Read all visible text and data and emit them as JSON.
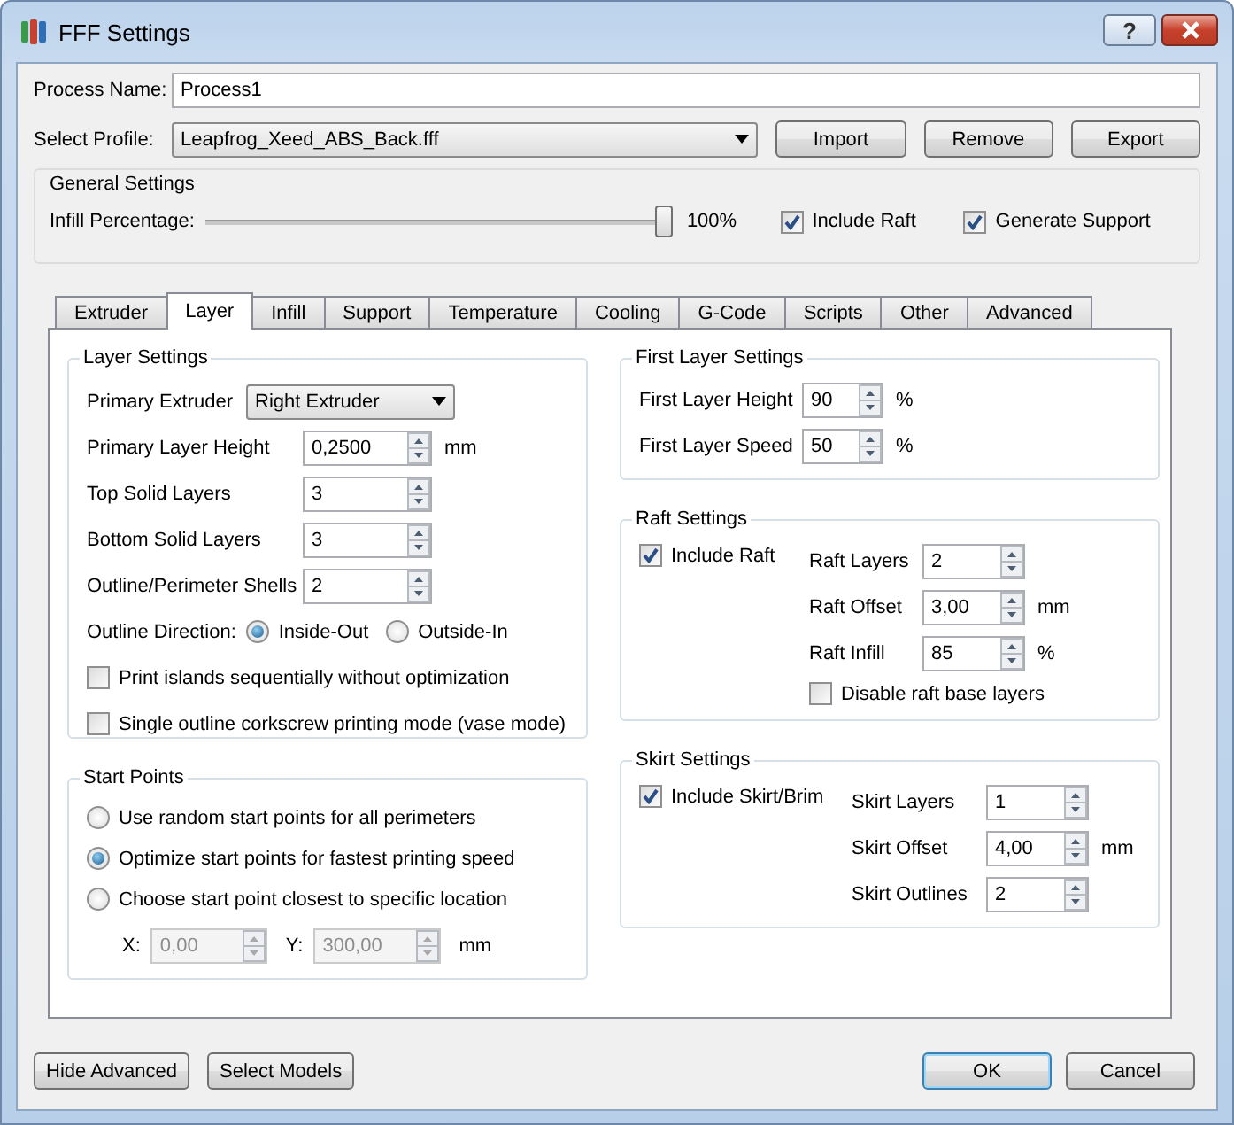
{
  "window": {
    "title": "FFF Settings",
    "help": "?"
  },
  "process_name": {
    "label": "Process Name:",
    "value": "Process1"
  },
  "profile": {
    "label": "Select Profile:",
    "value": "Leapfrog_Xeed_ABS_Back.fff",
    "buttons": [
      "Import",
      "Remove",
      "Export"
    ]
  },
  "general_settings": {
    "title": "General Settings",
    "infill": {
      "label": "Infill Percentage:",
      "level": 1,
      "reading": "100%"
    },
    "checkboxes": [
      {
        "label": "Include Raft",
        "checked": true
      },
      {
        "label": "Generate Support",
        "checked": true
      }
    ]
  },
  "tabs": [
    {
      "label": "Extruder",
      "selected": false
    },
    {
      "label": "Layer",
      "selected": true
    },
    {
      "label": "Infill",
      "selected": false
    },
    {
      "label": "Support",
      "selected": false
    },
    {
      "label": "Temperature",
      "selected": false
    },
    {
      "label": "Cooling",
      "selected": false
    },
    {
      "label": "G-Code",
      "selected": false
    },
    {
      "label": "Scripts",
      "selected": false
    },
    {
      "label": "Other",
      "selected": false
    },
    {
      "label": "Advanced",
      "selected": false
    }
  ],
  "layer_settings": {
    "title": "Layer Settings",
    "rows": [
      {
        "kind": "combo",
        "label": "Primary Extruder",
        "value": "Right Extruder"
      },
      {
        "kind": "spin",
        "label": "Primary Layer Height",
        "value": "0,2500",
        "unit": "mm"
      },
      {
        "kind": "spin",
        "label": "Top Solid Layers",
        "value": "3"
      },
      {
        "kind": "spin",
        "label": "Bottom Solid Layers",
        "value": "3"
      },
      {
        "kind": "spin",
        "label": "Outline/Perimeter Shells",
        "value": "2"
      },
      {
        "kind": "radio",
        "label": "Outline Direction:",
        "options": [
          {
            "label": "Inside-Out",
            "selected": true
          },
          {
            "label": "Outside-In",
            "selected": false
          }
        ]
      },
      {
        "kind": "checkbox",
        "label": "Print islands sequentially without optimization",
        "checked": false
      },
      {
        "kind": "checkbox",
        "label": "Single outline corkscrew printing mode (vase mode)",
        "checked": false
      }
    ]
  },
  "start_points": {
    "title": "Start Points",
    "options": [
      {
        "label": "Use random start points for all perimeters",
        "selected": false
      },
      {
        "label": "Optimize start points for fastest printing speed",
        "selected": true
      },
      {
        "label": "Choose start point closest to specific location",
        "selected": false
      }
    ],
    "coords": [
      {
        "label": "X:",
        "value": "0,00",
        "disabled": true
      },
      {
        "label": "Y:",
        "value": "300,00",
        "disabled": true
      }
    ],
    "unit": "mm"
  },
  "first_layer": {
    "title": "First Layer Settings",
    "rows": [
      {
        "label": "First Layer Height",
        "value": "90",
        "unit": "%"
      },
      {
        "label": "First Layer Speed",
        "value": "50",
        "unit": "%"
      }
    ]
  },
  "raft": {
    "title": "Raft Settings",
    "include": {
      "label": "Include Raft",
      "checked": true
    },
    "rows": [
      {
        "label": "Raft Layers",
        "value": "2"
      },
      {
        "label": "Raft Offset",
        "value": "3,00",
        "unit": "mm"
      },
      {
        "label": "Raft Infill",
        "value": "85",
        "unit": "%"
      }
    ],
    "extra": {
      "label": "Disable raft base layers",
      "checked": false
    }
  },
  "skirt": {
    "title": "Skirt Settings",
    "include": {
      "label": "Include Skirt/Brim",
      "checked": true
    },
    "rows": [
      {
        "label": "Skirt Layers",
        "value": "1"
      },
      {
        "label": "Skirt Offset",
        "value": "4,00",
        "unit": "mm"
      },
      {
        "label": "Skirt Outlines",
        "value": "2"
      }
    ]
  },
  "footer": {
    "left": [
      "Hide Advanced",
      "Select Models"
    ],
    "right": [
      {
        "label": "OK",
        "default": true
      },
      {
        "label": "Cancel",
        "default": false
      }
    ]
  }
}
